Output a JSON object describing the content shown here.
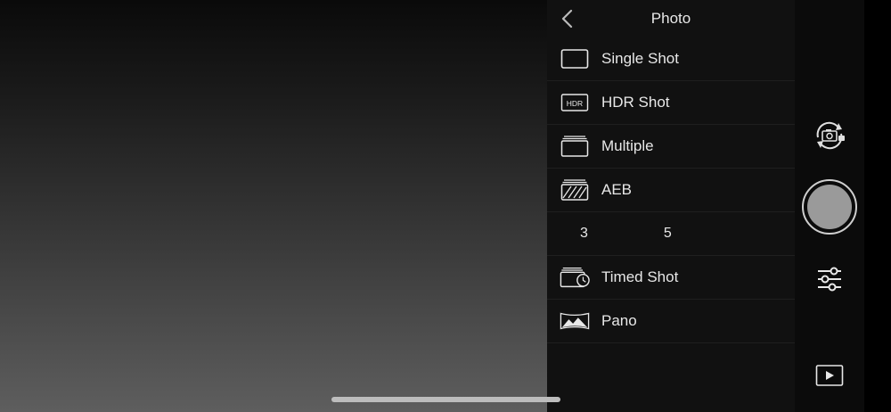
{
  "header": {
    "title": "Photo"
  },
  "menu": {
    "items": [
      {
        "label": "Single Shot",
        "icon": "single-shot-icon"
      },
      {
        "label": "HDR Shot",
        "icon": "hdr-icon",
        "icon_text": "HDR"
      },
      {
        "label": "Multiple",
        "icon": "multiple-icon"
      },
      {
        "label": "AEB",
        "icon": "aeb-icon"
      },
      {
        "label": "Timed Shot",
        "icon": "timed-shot-icon"
      },
      {
        "label": "Pano",
        "icon": "pano-icon"
      }
    ],
    "aeb_options": [
      "3",
      "5"
    ]
  },
  "rail": {
    "icons": [
      "camera-switch-icon",
      "shutter-button",
      "sliders-icon",
      "play-icon"
    ]
  },
  "colors": {
    "panel_bg": "#111111",
    "rail_bg": "#0b0b0b",
    "text": "#e8e8e8",
    "shutter_fill": "#9a9a9a"
  }
}
